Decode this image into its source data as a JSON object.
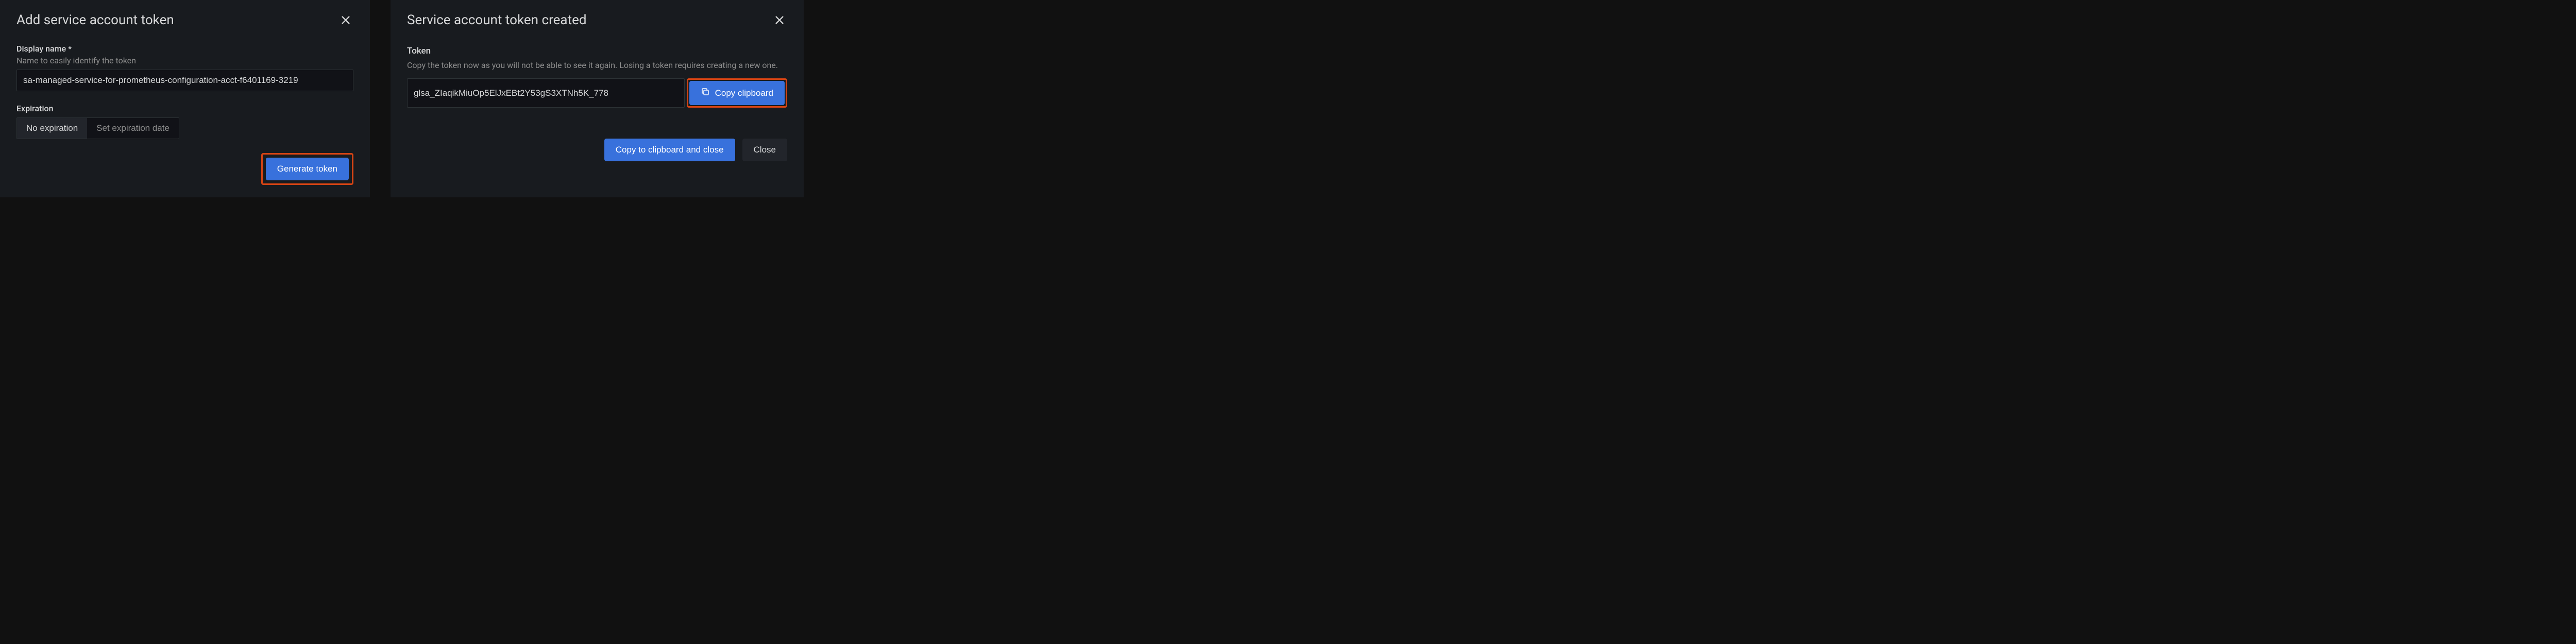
{
  "modal_add": {
    "title": "Add service account token",
    "display_name": {
      "label": "Display name *",
      "help": "Name to easily identify the token",
      "value": "sa-managed-service-for-prometheus-configuration-acct-f6401169-3219"
    },
    "expiration": {
      "label": "Expiration",
      "no_expiration": "No expiration",
      "set_expiration": "Set expiration date"
    },
    "generate_button": "Generate token"
  },
  "modal_created": {
    "title": "Service account token created",
    "token": {
      "label": "Token",
      "help": "Copy the token now as you will not be able to see it again. Losing a token requires creating a new one.",
      "value": "glsa_ZIaqikMiuOp5ElJxEBt2Y53gS3XTNh5K_778"
    },
    "copy_clipboard_button": "Copy clipboard",
    "copy_and_close_button": "Copy to clipboard and close",
    "close_button": "Close"
  }
}
